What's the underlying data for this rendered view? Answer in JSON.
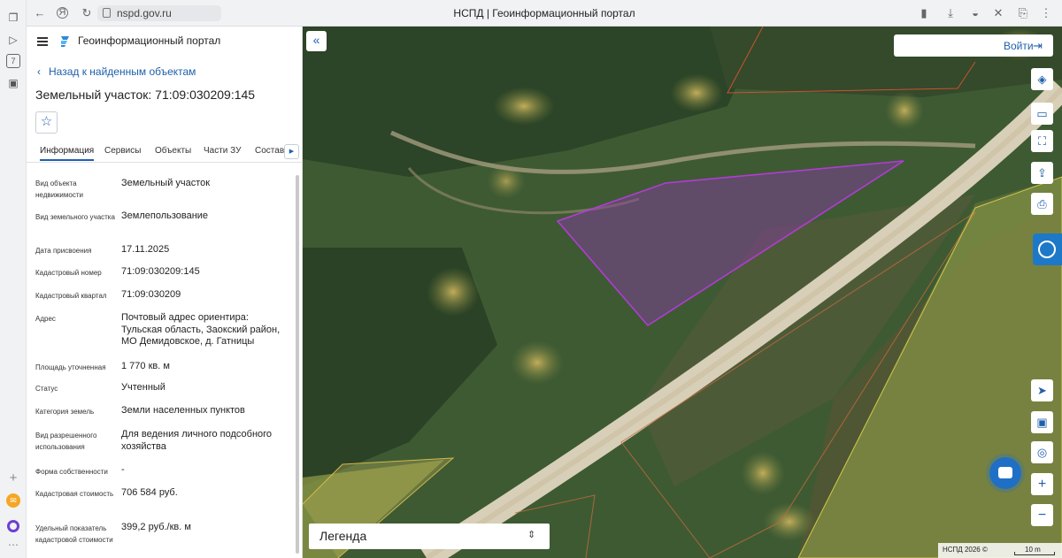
{
  "browser": {
    "url": "nspd.gov.ru",
    "tab_title": "НСПД | Геоинформационный портал",
    "sidebar_icons": [
      "tabs-icon",
      "play-icon",
      "calendar-icon",
      "camera-icon",
      "plus-icon",
      "mail-icon",
      "alice-icon",
      "more-icon"
    ],
    "calendar_day": "7"
  },
  "header": {
    "portal_title": "Геоинформационный портал"
  },
  "panel": {
    "back_label": "Назад к найденным объектам",
    "back_chevron": "‹",
    "object_title": "Земельный участок: 71:09:030209:145",
    "tabs": [
      {
        "label": "Информация",
        "active": true
      },
      {
        "label": "Сервисы"
      },
      {
        "label": "Объекты"
      },
      {
        "label": "Части ЗУ"
      },
      {
        "label": "Состав"
      }
    ],
    "fields": [
      {
        "label": "Вид объекта недвижимости",
        "value": "Земельный участок"
      },
      {
        "label": "Вид земельного участка",
        "value": "Землепользование"
      },
      {
        "label": "Дата присвоения",
        "value": "17.11.2025"
      },
      {
        "label": "Кадастровый номер",
        "value": "71:09:030209:145"
      },
      {
        "label": "Кадастровый квартал",
        "value": "71:09:030209"
      },
      {
        "label": "Адрес",
        "value": "Почтовый адрес ориентира: Тульская область, Заокский район, МО Демидовское, д. Гатницы"
      },
      {
        "label": "Площадь уточненная",
        "value": "1 770 кв. м"
      },
      {
        "label": "Статус",
        "value": "Учтенный"
      },
      {
        "label": "Категория земель",
        "value": "Земли населенных пунктов"
      },
      {
        "label": "Вид разрешенного использования",
        "value": "Для ведения личного подсобного хозяйства"
      },
      {
        "label": "Форма собственности",
        "value": "-"
      },
      {
        "label": "Кадастровая стоимость",
        "value": "706 584 руб."
      },
      {
        "label": "Удельный показатель кадастровой стоимости",
        "value": "399,2 руб./кв. м"
      }
    ]
  },
  "map": {
    "login_label": "Войти",
    "legend_label": "Легенда",
    "attribution": "НСПД 2026 ©",
    "scale_label": "10 m",
    "parcel_color": "#a23fc4",
    "colors": {
      "accent": "#1f5faa",
      "chat": "#1f6fc6"
    }
  }
}
